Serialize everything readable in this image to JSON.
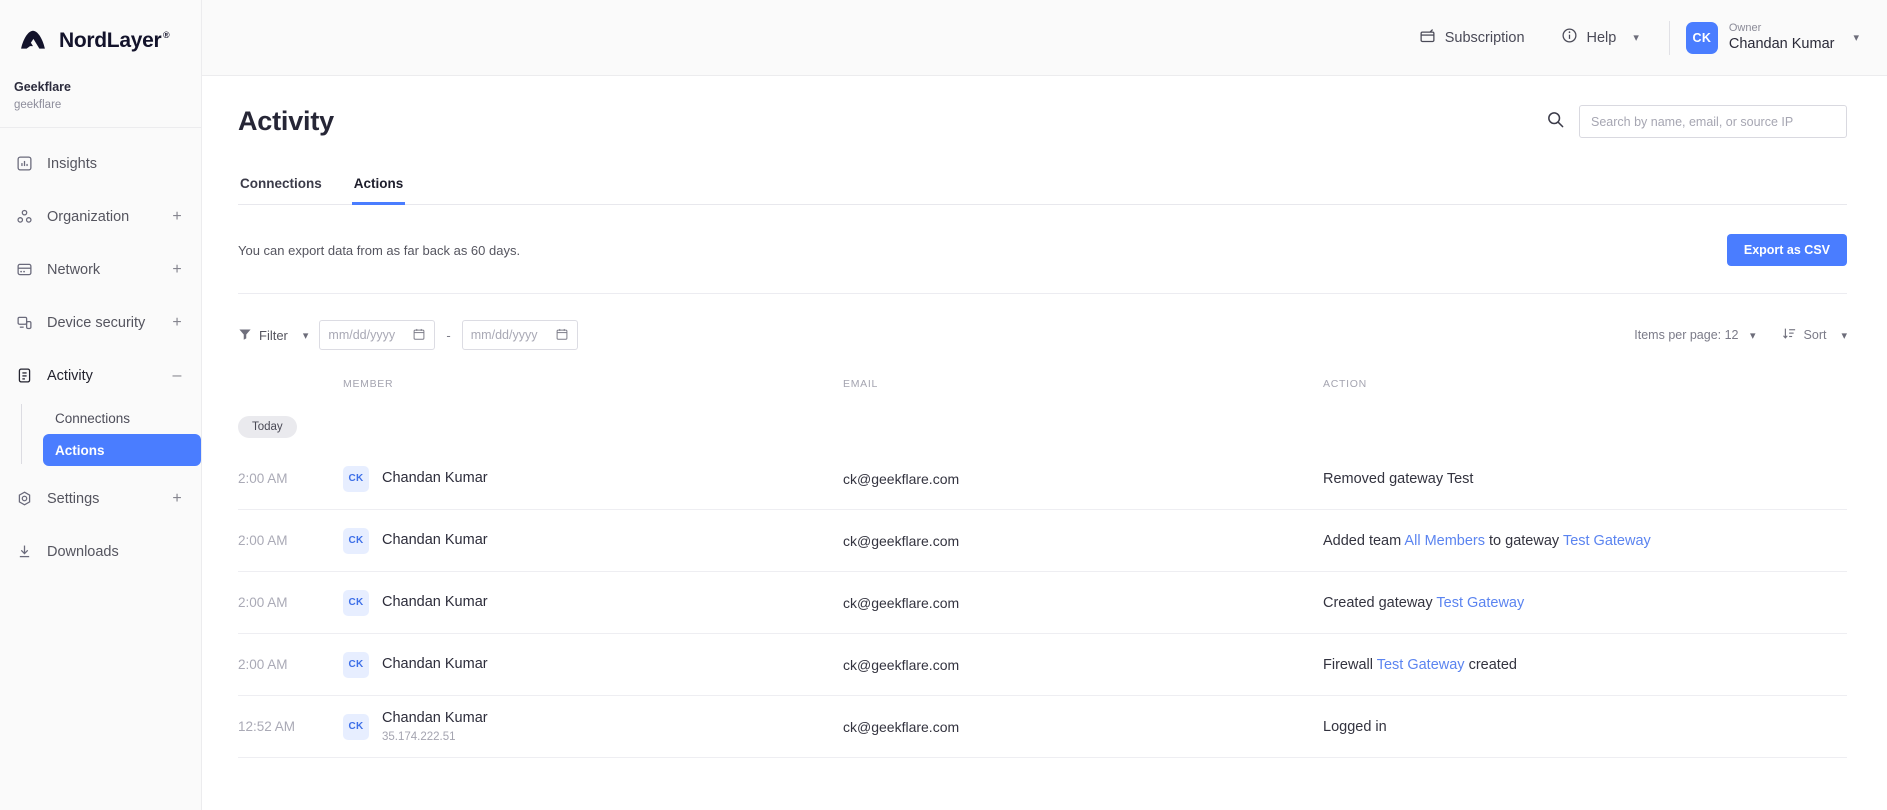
{
  "brand": {
    "name": "NordLayer",
    "trademark": "®"
  },
  "org": {
    "name": "Geekflare",
    "slug": "geekflare"
  },
  "sidebar": {
    "items": [
      {
        "label": "Insights",
        "icon": "insights-icon",
        "expander": ""
      },
      {
        "label": "Organization",
        "icon": "organization-icon",
        "expander": "+"
      },
      {
        "label": "Network",
        "icon": "network-icon",
        "expander": "+"
      },
      {
        "label": "Device security",
        "icon": "device-security-icon",
        "expander": "+"
      },
      {
        "label": "Activity",
        "icon": "activity-icon",
        "expander": "–"
      }
    ],
    "activity_children": [
      {
        "label": "Connections",
        "selected": false
      },
      {
        "label": "Actions",
        "selected": true
      }
    ],
    "footer_items": [
      {
        "label": "Settings",
        "icon": "settings-icon",
        "expander": "+"
      },
      {
        "label": "Downloads",
        "icon": "downloads-icon",
        "expander": ""
      }
    ]
  },
  "topbar": {
    "subscription_label": "Subscription",
    "help_label": "Help",
    "user": {
      "initials": "CK",
      "role": "Owner",
      "name": "Chandan Kumar"
    }
  },
  "page": {
    "title": "Activity",
    "search_placeholder": "Search by name, email, or source IP",
    "search_value": ""
  },
  "tabs": [
    {
      "label": "Connections",
      "active": false
    },
    {
      "label": "Actions",
      "active": true
    }
  ],
  "export": {
    "note": "You can export data from as far back as 60 days.",
    "button_label": "Export as CSV"
  },
  "filters": {
    "filter_label": "Filter",
    "date_from_placeholder": "mm/dd/yyyy",
    "date_to_placeholder": "mm/dd/yyyy",
    "range_separator": "-",
    "items_per_page_label": "Items per page: 12",
    "sort_label": "Sort"
  },
  "table": {
    "headers": {
      "time": "",
      "member": "MEMBER",
      "email": "EMAIL",
      "action": "ACTION"
    },
    "group_label": "Today",
    "rows": [
      {
        "time": "2:00 AM",
        "initials": "CK",
        "name": "Chandan Kumar",
        "ip": "",
        "email": "ck@geekflare.com",
        "action_parts": [
          {
            "text": "Removed gateway Test",
            "link": false
          }
        ]
      },
      {
        "time": "2:00 AM",
        "initials": "CK",
        "name": "Chandan Kumar",
        "ip": "",
        "email": "ck@geekflare.com",
        "action_parts": [
          {
            "text": "Added team ",
            "link": false
          },
          {
            "text": "All Members",
            "link": true
          },
          {
            "text": " to gateway ",
            "link": false
          },
          {
            "text": "Test Gateway",
            "link": true
          }
        ]
      },
      {
        "time": "2:00 AM",
        "initials": "CK",
        "name": "Chandan Kumar",
        "ip": "",
        "email": "ck@geekflare.com",
        "action_parts": [
          {
            "text": "Created gateway ",
            "link": false
          },
          {
            "text": "Test Gateway",
            "link": true
          }
        ]
      },
      {
        "time": "2:00 AM",
        "initials": "CK",
        "name": "Chandan Kumar",
        "ip": "",
        "email": "ck@geekflare.com",
        "action_parts": [
          {
            "text": "Firewall ",
            "link": false
          },
          {
            "text": "Test Gateway",
            "link": true
          },
          {
            "text": " created",
            "link": false
          }
        ]
      },
      {
        "time": "12:52 AM",
        "initials": "CK",
        "name": "Chandan Kumar",
        "ip": "35.174.222.51",
        "email": "ck@geekflare.com",
        "action_parts": [
          {
            "text": "Logged in",
            "link": false
          }
        ]
      }
    ]
  },
  "colors": {
    "accent": "#4a7dff",
    "link": "#5b84f0",
    "sidebar_bg": "#fafafa",
    "avatar_soft_bg": "#e7eeff",
    "logo_navy": "#13132b"
  }
}
